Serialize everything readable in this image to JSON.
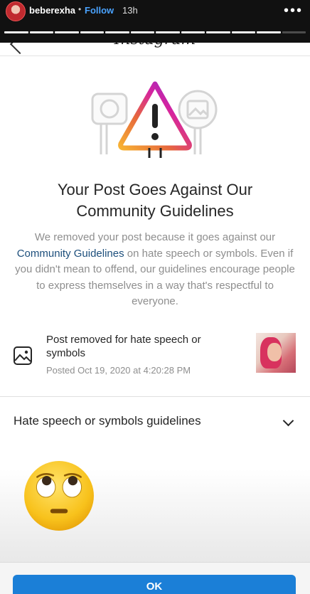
{
  "story": {
    "username": "beberexha",
    "dot": "•",
    "follow": "Follow",
    "time": "13h",
    "more": "•••",
    "progress": {
      "total_segments": 12,
      "completed": 11
    }
  },
  "sheet": {
    "header_logo": "Instagram",
    "title_line1": "Your Post Goes Against Our",
    "title_line2": "Community Guidelines",
    "desc_before": "We removed your post because it goes against our ",
    "desc_link": "Community Guidelines",
    "desc_after": " on hate speech or symbols. Even if you didn't mean to offend, our guidelines encourage people to express themselves in a way that's respectful to everyone.",
    "removed_title": "Post removed for hate speech or symbols",
    "posted": "Posted Oct 19, 2020 at 4:20:28 PM",
    "guidelines_label": "Hate speech or symbols guidelines",
    "ok_label": "OK"
  },
  "colors": {
    "link": "#1d4f7c",
    "follow": "#4aa3ff",
    "ok_button": "#1b7fd7"
  },
  "icons": {
    "warning": "warning-triangle-icon",
    "image": "image-icon",
    "chevron": "chevron-down-icon",
    "emoji": "face-with-rolling-eyes"
  }
}
